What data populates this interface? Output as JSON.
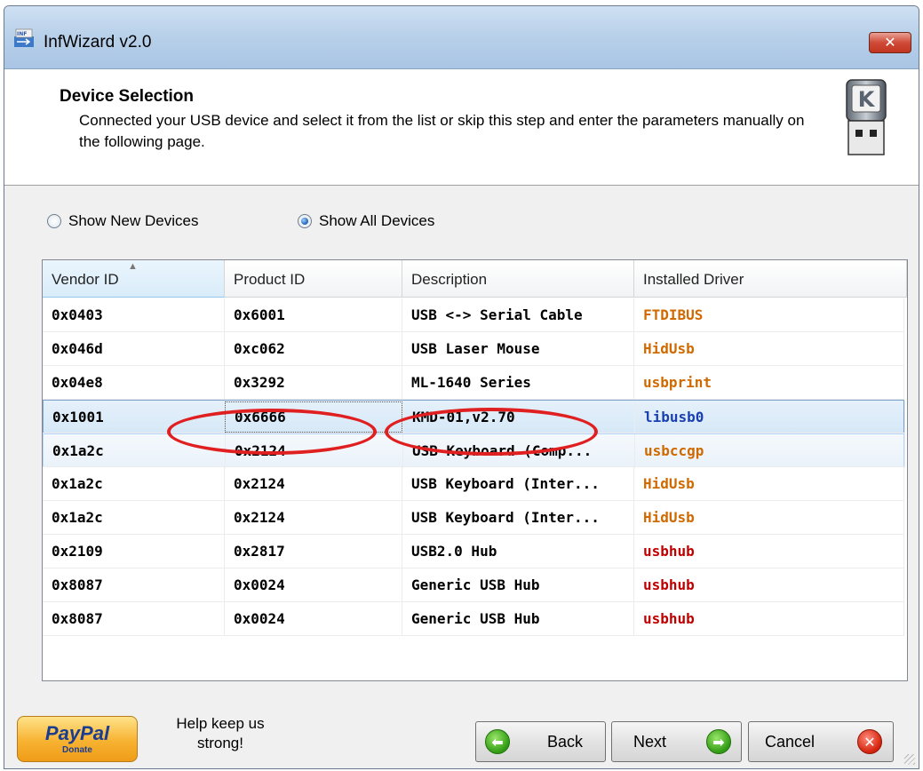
{
  "window": {
    "title": "InfWizard v2.0",
    "close_label": "✕"
  },
  "header": {
    "title": "Device Selection",
    "description": "Connected your USB device and select it from the list or skip this step and enter the parameters manually on the following page."
  },
  "radios": {
    "new_devices": {
      "label": "Show New Devices",
      "checked": false
    },
    "all_devices": {
      "label": "Show All Devices",
      "checked": true
    }
  },
  "table": {
    "columns": [
      "Vendor ID",
      "Product ID",
      "Description",
      "Installed Driver"
    ],
    "sorted_column": "Vendor ID",
    "rows": [
      {
        "vendor": "0x0403",
        "product": "0x6001",
        "description": "USB <-> Serial Cable",
        "driver": "FTDIBUS",
        "driver_color": "#d06a00"
      },
      {
        "vendor": "0x046d",
        "product": "0xc062",
        "description": "USB Laser Mouse",
        "driver": "HidUsb",
        "driver_color": "#d06a00"
      },
      {
        "vendor": "0x04e8",
        "product": "0x3292",
        "description": "ML-1640 Series",
        "driver": "usbprint",
        "driver_color": "#d06a00"
      },
      {
        "vendor": "0x1001",
        "product": "0x6666",
        "description": "KMD-01,v2.70",
        "driver": "libusb0",
        "driver_color": "#1a3fb0"
      },
      {
        "vendor": "0x1a2c",
        "product": "0x2124",
        "description": "USB Keyboard (Comp...",
        "driver": "usbccgp",
        "driver_color": "#d06a00"
      },
      {
        "vendor": "0x1a2c",
        "product": "0x2124",
        "description": "USB Keyboard (Inter...",
        "driver": "HidUsb",
        "driver_color": "#d06a00"
      },
      {
        "vendor": "0x1a2c",
        "product": "0x2124",
        "description": "USB Keyboard (Inter...",
        "driver": "HidUsb",
        "driver_color": "#d06a00"
      },
      {
        "vendor": "0x2109",
        "product": "0x2817",
        "description": "USB2.0 Hub",
        "driver": "usbhub",
        "driver_color": "#c00000"
      },
      {
        "vendor": "0x8087",
        "product": "0x0024",
        "description": "Generic USB Hub",
        "driver": "usbhub",
        "driver_color": "#c00000"
      },
      {
        "vendor": "0x8087",
        "product": "0x0024",
        "description": "Generic USB Hub",
        "driver": "usbhub",
        "driver_color": "#c00000"
      }
    ]
  },
  "footer": {
    "paypal_label": "PayPal",
    "paypal_sub": "Donate",
    "help_text": "Help keep us strong!",
    "back_label": "Back",
    "next_label": "Next",
    "cancel_label": "Cancel"
  },
  "usb_icon_letter": "K",
  "icons": [
    "app-icon",
    "usb-drive-icon",
    "sort-ascending-icon",
    "back-arrow-icon",
    "next-arrow-icon",
    "cancel-icon",
    "resize-grip-icon"
  ]
}
